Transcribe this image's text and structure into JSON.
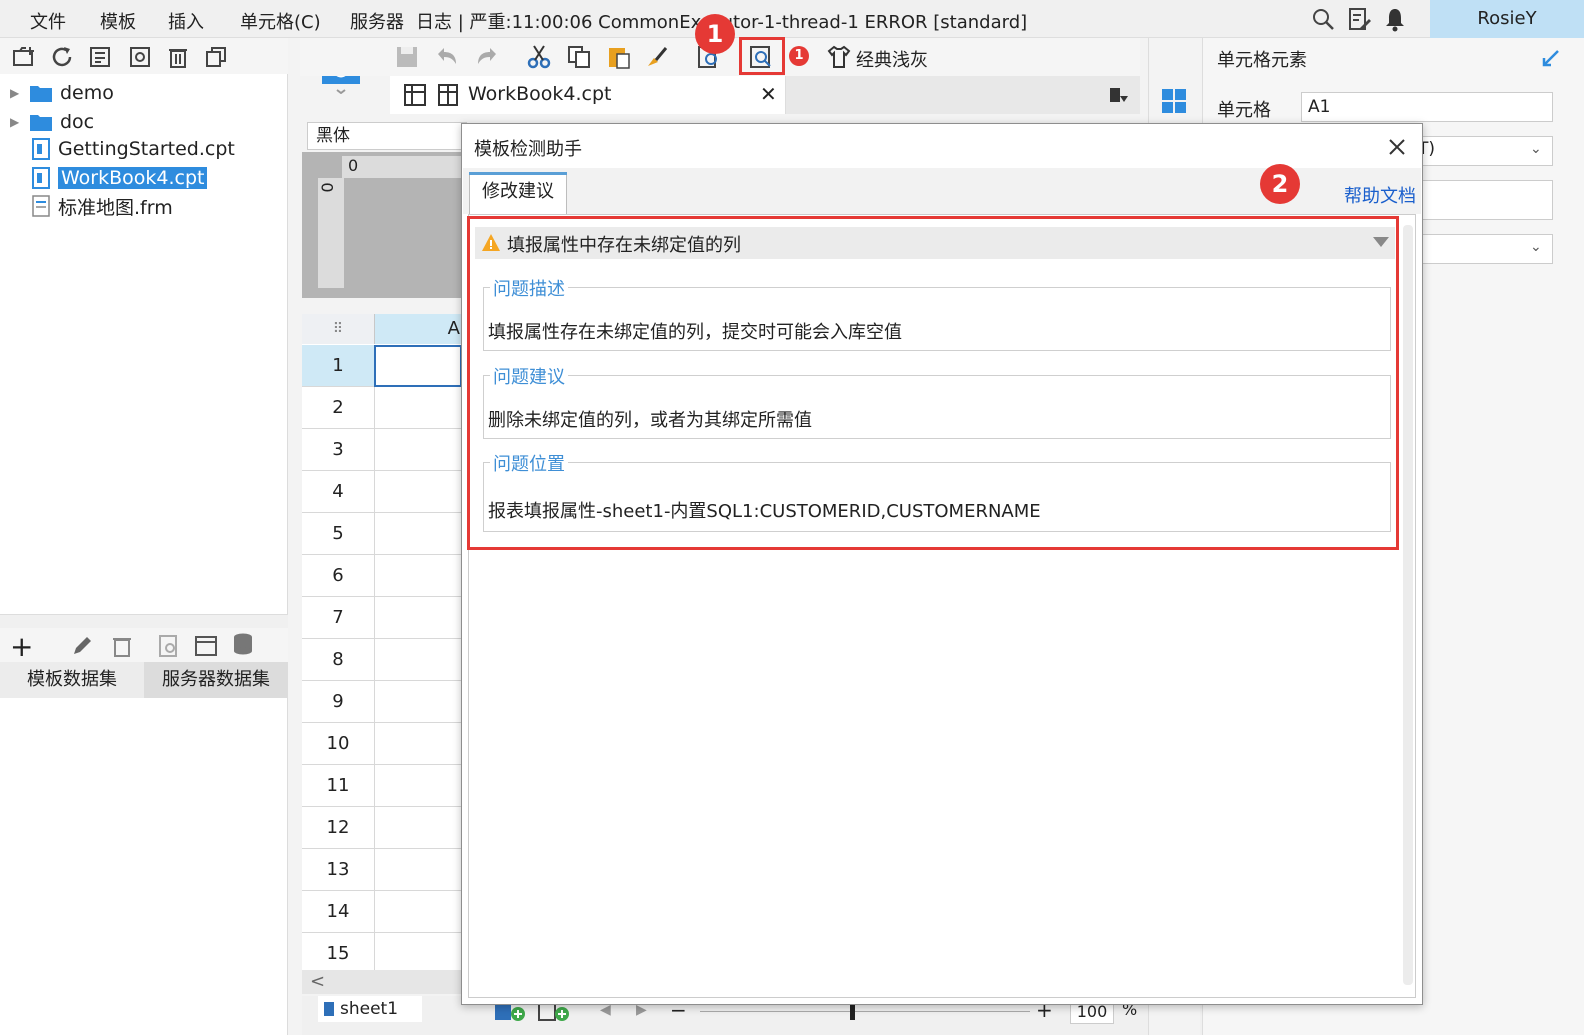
{
  "menubar": {
    "items": [
      "文件",
      "模板",
      "插入",
      "单元格(C)",
      "服务器"
    ],
    "log_text": "日志 | 严重:11:00:06 CommonExecutor-1-thread-1 ERROR [standard]",
    "user": "RosieY"
  },
  "file_tree": {
    "items": [
      {
        "label": "demo",
        "type": "folder"
      },
      {
        "label": "doc",
        "type": "folder"
      },
      {
        "label": "GettingStarted.cpt",
        "type": "file"
      },
      {
        "label": "WorkBook4.cpt",
        "type": "file",
        "selected": true
      },
      {
        "label": "标准地图.frm",
        "type": "file"
      }
    ]
  },
  "datasets": {
    "tabs": [
      "模板数据集",
      "服务器数据集"
    ]
  },
  "toolbar": {
    "theme_label": "经典浅灰",
    "notification_count": "1"
  },
  "document": {
    "tab_label": "WorkBook4.cpt",
    "font_name": "黑体"
  },
  "grid": {
    "column_header": "A",
    "rows": [
      "1",
      "2",
      "3",
      "4",
      "5",
      "6",
      "7",
      "8",
      "9",
      "10",
      "11",
      "12",
      "13",
      "14",
      "15"
    ],
    "ruler_zero_top": "0",
    "ruler_zero_left": "0"
  },
  "sheet": {
    "tab_label": "sheet1",
    "zoom": "100",
    "zoom_unit": "%"
  },
  "right_panel": {
    "title": "单元格元素",
    "cell_label": "单元格",
    "cell_value": "A1",
    "partial_text": "T)"
  },
  "dialog": {
    "title": "模板检测助手",
    "tab_label": "修改建议",
    "help_link": "帮助文档",
    "issue_title": "填报属性中存在未绑定值的列",
    "groups": [
      {
        "legend": "问题描述",
        "text": "填报属性存在未绑定值的列，提交时可能会入库空值"
      },
      {
        "legend": "问题建议",
        "text": "删除未绑定值的列，或者为其绑定所需值"
      },
      {
        "legend": "问题位置",
        "text": "报表填报属性-sheet1-内置SQL1:CUSTOMERID,CUSTOMERNAME"
      }
    ]
  },
  "annotations": {
    "badge_1": "1",
    "badge_2": "2"
  },
  "colors": {
    "accent": "#2e8cde",
    "annotation_red": "#e53935",
    "legend_blue": "#3f8fd6",
    "link_blue": "#1a5fcc"
  }
}
